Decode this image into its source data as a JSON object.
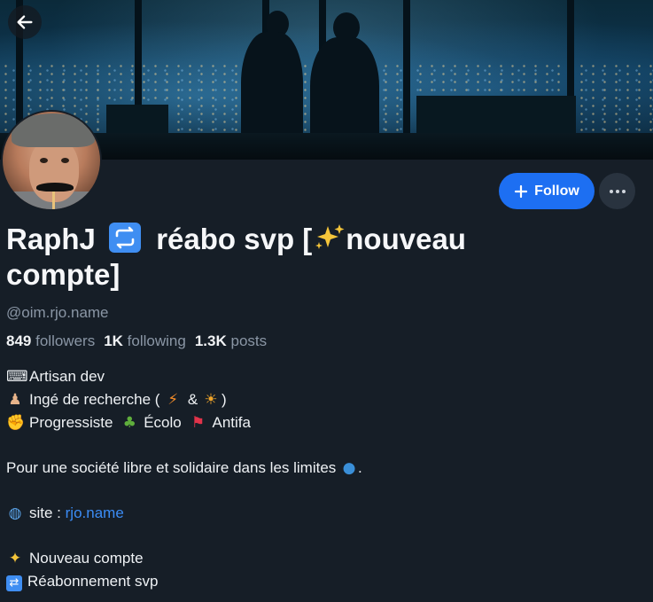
{
  "profile": {
    "name_part1": "RaphJ",
    "name_part2": "réabo svp [",
    "name_part3": "nouveau",
    "name_part4": "compte]",
    "handle": "@oim.rjo.name"
  },
  "stats": {
    "followers_count": "849",
    "followers_label": "followers",
    "following_count": "1K",
    "following_label": "following",
    "posts_count": "1.3K",
    "posts_label": "posts"
  },
  "actions": {
    "follow_label": "Follow"
  },
  "bio": {
    "line1": "Artisan dev",
    "line2_a": "Ingé de recherche (",
    "line2_b": "&",
    "line2_c": ")",
    "line3_a": "Progressiste",
    "line3_b": "Écolo",
    "line3_c": "Antifa",
    "line4": "Pour une société libre et solidaire dans les limites",
    "line4_end": ".",
    "site_label": "site :",
    "site_link": "rjo.name",
    "line6": "Nouveau compte",
    "line7": "Réabonnement svp"
  },
  "icons": {
    "back": "arrow-left-icon",
    "repost": "repost-icon",
    "sparkles": "sparkles-icon",
    "keyboard": "keyboard-icon",
    "scientist": "scientist-icon",
    "lightning": "lightning-icon",
    "sun": "sun-icon",
    "fist": "raised-fist-icon",
    "tree": "tree-icon",
    "flag": "red-flag-icon",
    "globe-earth": "earth-globe-icon",
    "globe-web": "globe-icon",
    "plus": "plus-icon",
    "more": "more-dots-icon"
  },
  "colors": {
    "background": "#161e27",
    "accent": "#1d6ff2",
    "link": "#3b8cf5",
    "muted": "#8a96a5"
  }
}
